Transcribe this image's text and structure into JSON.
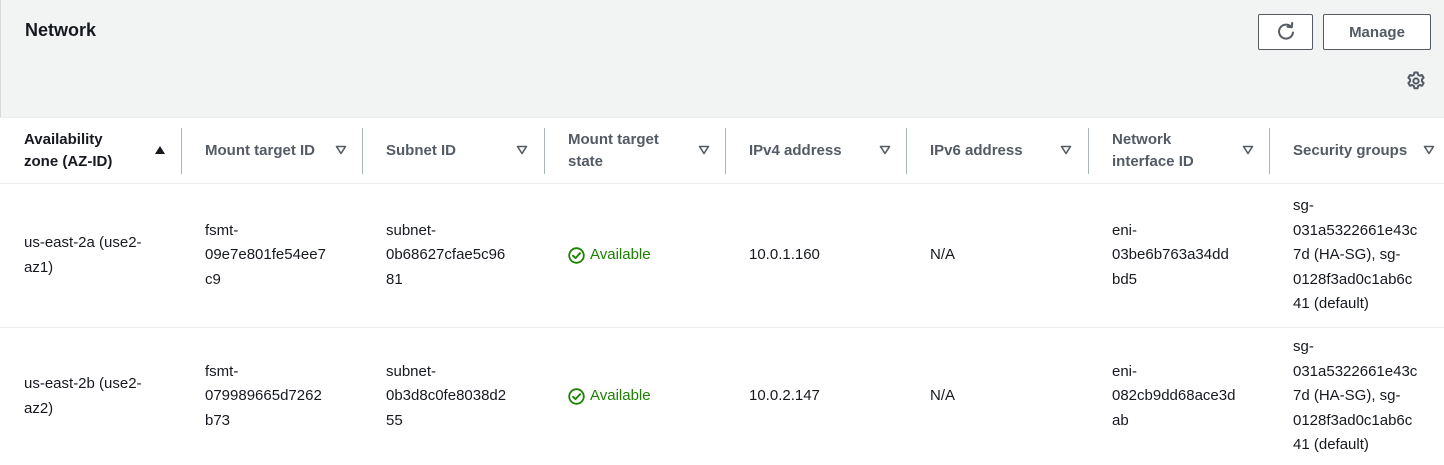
{
  "header": {
    "title": "Network",
    "manage_label": "Manage",
    "refresh_icon": "refresh-icon",
    "settings_icon": "gear-icon"
  },
  "columns": [
    {
      "label": "Availability\nzone (AZ-ID)",
      "sort": "ascending"
    },
    {
      "label": "Mount target ID",
      "sort": "none"
    },
    {
      "label": "Subnet ID",
      "sort": "none"
    },
    {
      "label": "Mount target\nstate",
      "sort": "none"
    },
    {
      "label": "IPv4 address",
      "sort": "none"
    },
    {
      "label": "IPv6 address",
      "sort": "none"
    },
    {
      "label": "Network\ninterface ID",
      "sort": "none"
    },
    {
      "label": "Security groups",
      "sort": "none"
    }
  ],
  "rows": [
    {
      "az": "us-east-2a (use2-\naz1)",
      "mount_target_id": "fsmt-\n09e7e801fe54ee7\nc9",
      "subnet_id": "subnet-\n0b68627cfae5c96\n81",
      "state": "Available",
      "ipv4": "10.0.1.160",
      "ipv6": "N/A",
      "eni": "eni-\n03be6b763a34dd\nbd5",
      "security_groups": "sg-\n031a5322661e43c\n7d (HA-SG), sg-\n0128f3ad0c1ab6c\n41 (default)"
    },
    {
      "az": "us-east-2b (use2-\naz2)",
      "mount_target_id": "fsmt-\n079989665d7262\nb73",
      "subnet_id": "subnet-\n0b3d8c0fe8038d2\n55",
      "state": "Available",
      "ipv4": "10.0.2.147",
      "ipv6": "N/A",
      "eni": "eni-\n082cb9dd68ace3d\nab",
      "security_groups": "sg-\n031a5322661e43c\n7d (HA-SG), sg-\n0128f3ad0c1ab6c\n41 (default)"
    }
  ],
  "colors": {
    "status_available": "#1d8102",
    "header_bg": "#f2f3f3",
    "text": "#16191f",
    "muted": "#545b64"
  }
}
